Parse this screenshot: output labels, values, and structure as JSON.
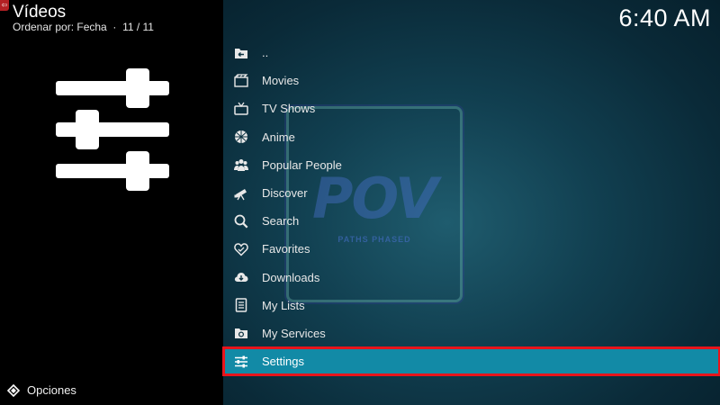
{
  "header": {
    "title": "Vídeos",
    "sort_label": "Ordenar por: Fecha",
    "separator": "·",
    "count": "11 / 11",
    "clock": "6:40 AM"
  },
  "footer": {
    "options_label": "Opciones"
  },
  "watermark": {
    "text": "POV",
    "subtext": "PATHS PHASED"
  },
  "menu": {
    "items": [
      {
        "label": "..",
        "icon": "folder-back-icon"
      },
      {
        "label": "Movies",
        "icon": "film-icon"
      },
      {
        "label": "TV Shows",
        "icon": "tv-icon"
      },
      {
        "label": "Anime",
        "icon": "grid-circle-icon"
      },
      {
        "label": "Popular People",
        "icon": "people-icon"
      },
      {
        "label": "Discover",
        "icon": "telescope-icon"
      },
      {
        "label": "Search",
        "icon": "search-icon"
      },
      {
        "label": "Favorites",
        "icon": "heart-icon"
      },
      {
        "label": "Downloads",
        "icon": "cloud-download-icon"
      },
      {
        "label": "My Lists",
        "icon": "list-icon"
      },
      {
        "label": "My Services",
        "icon": "services-icon"
      },
      {
        "label": "Settings",
        "icon": "settings-sliders-icon",
        "selected": true
      }
    ]
  },
  "colors": {
    "selected_bg": "#128aa6",
    "selected_border": "#e8141b"
  }
}
